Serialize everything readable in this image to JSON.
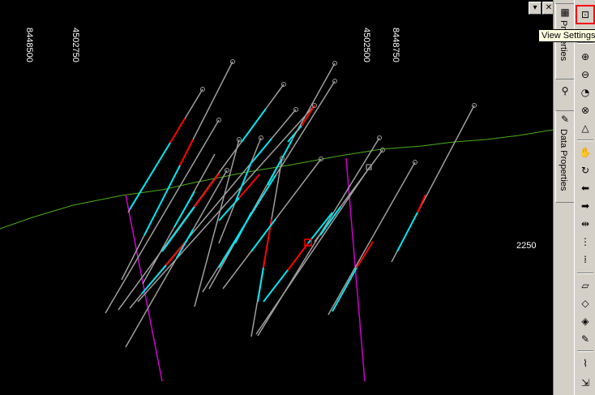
{
  "window": {
    "dropdown_glyph": "▾",
    "close_glyph": "✕"
  },
  "axes": {
    "x_labels": [
      "8448500",
      "4502750",
      "4502500",
      "8448750"
    ],
    "elevation_label": "2250"
  },
  "side_tabs": [
    {
      "label": "Properties",
      "icon": "properties-icon"
    },
    {
      "label": "Data Properties",
      "icon": "data-properties-icon"
    }
  ],
  "toolbar": {
    "view_settings_tooltip": "View Settings",
    "buttons": [
      {
        "icon": "view-settings-icon",
        "glyph": "⊡"
      },
      {
        "icon": "zoom-in-icon",
        "glyph": "⊕"
      },
      {
        "icon": "zoom-out-icon",
        "glyph": "⊖"
      },
      {
        "icon": "zoom-previous-icon",
        "glyph": "◔"
      },
      {
        "icon": "zoom-extents-icon",
        "glyph": "⊗"
      },
      {
        "icon": "measure-icon",
        "glyph": "△"
      },
      {
        "icon": "pan-icon",
        "glyph": "✋"
      },
      {
        "icon": "rotate-icon",
        "glyph": "↻"
      },
      {
        "icon": "move-left-icon",
        "glyph": "⬅"
      },
      {
        "icon": "move-right-icon",
        "glyph": "➡"
      },
      {
        "icon": "section-line-icon",
        "glyph": "⇹"
      },
      {
        "icon": "grid-lines-icon",
        "glyph": "⋮"
      },
      {
        "icon": "grid-dots-icon",
        "glyph": "⁞"
      },
      {
        "icon": "plane-view-icon",
        "glyph": "▱"
      },
      {
        "icon": "plane-dot-icon",
        "glyph": "◇"
      },
      {
        "icon": "plane-both-icon",
        "glyph": "◈"
      },
      {
        "icon": "plane-edit-icon",
        "glyph": "✎"
      },
      {
        "icon": "brush-select-icon",
        "glyph": "⌇"
      },
      {
        "icon": "export-icon",
        "glyph": "⇲"
      }
    ]
  },
  "colors": {
    "background": "#000000",
    "topography": "#4caf1a",
    "hole_grey": "#9e9e9e",
    "hole_cyan": "#00e5ee",
    "hole_red": "#ff0000",
    "fault_magenta": "#d000d0",
    "highlight_border": "#ff0000"
  }
}
